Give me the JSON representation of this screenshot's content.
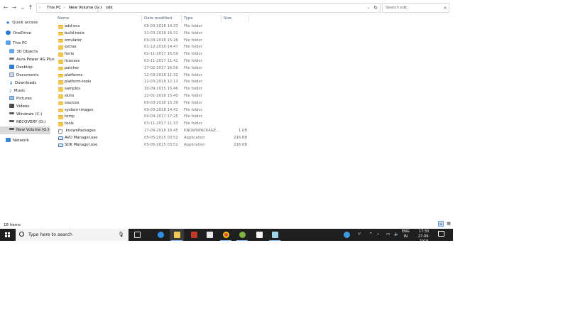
{
  "address_bar": {
    "back": "←",
    "forward": "→",
    "recent": "⌄",
    "up": "↑",
    "breadcrumbs": [
      "This PC",
      "New Volume (G:)",
      "sdk"
    ],
    "dropdown": "⌄",
    "refresh": "↻"
  },
  "search": {
    "placeholder": "Search sdk"
  },
  "nav": {
    "items": [
      {
        "label": "Quick access",
        "icon": "star-icon"
      },
      {
        "label": "OneDrive",
        "icon": "cloud-icon"
      },
      {
        "label": "This PC",
        "icon": "computer-icon"
      },
      {
        "label": "3D Objects",
        "icon": "cube-icon"
      },
      {
        "label": "Aura Power 4G Plus",
        "icon": "phone-drive-icon"
      },
      {
        "label": "Desktop",
        "icon": "desktop-icon"
      },
      {
        "label": "Documents",
        "icon": "documents-icon"
      },
      {
        "label": "Downloads",
        "icon": "download-icon"
      },
      {
        "label": "Music",
        "icon": "music-icon"
      },
      {
        "label": "Pictures",
        "icon": "pictures-icon"
      },
      {
        "label": "Videos",
        "icon": "videos-icon"
      },
      {
        "label": "Windows (C:)",
        "icon": "drive-icon"
      },
      {
        "label": "RECOVERY (D:)",
        "icon": "drive-icon"
      },
      {
        "label": "New Volume (G:)",
        "icon": "drive-icon"
      },
      {
        "label": "Network",
        "icon": "network-icon"
      }
    ]
  },
  "columns": {
    "name": "Name",
    "date": "Date modified",
    "type": "Type",
    "size": "Size"
  },
  "files": [
    {
      "name": "add-ons",
      "date": "09-03-2018 14:33",
      "type": "File folder",
      "size": "",
      "kind": "folder"
    },
    {
      "name": "build-tools",
      "date": "31-03-2018 16:31",
      "type": "File folder",
      "size": "",
      "kind": "folder"
    },
    {
      "name": "emulator",
      "date": "09-03-2018 15:26",
      "type": "File folder",
      "size": "",
      "kind": "folder"
    },
    {
      "name": "extras",
      "date": "01-12-2016 14:47",
      "type": "File folder",
      "size": "",
      "kind": "folder"
    },
    {
      "name": "fonts",
      "date": "02-11-2017 16:59",
      "type": "File folder",
      "size": "",
      "kind": "folder"
    },
    {
      "name": "licenses",
      "date": "03-11-2017 11:41",
      "type": "File folder",
      "size": "",
      "kind": "folder"
    },
    {
      "name": "patcher",
      "date": "17-02-2017 16:59",
      "type": "File folder",
      "size": "",
      "kind": "folder"
    },
    {
      "name": "platforms",
      "date": "12-03-2018 11:32",
      "type": "File folder",
      "size": "",
      "kind": "folder"
    },
    {
      "name": "platform-tools",
      "date": "22-03-2018 12:13",
      "type": "File folder",
      "size": "",
      "kind": "folder"
    },
    {
      "name": "samples",
      "date": "30-09-2015 15:46",
      "type": "File folder",
      "size": "",
      "kind": "folder"
    },
    {
      "name": "skins",
      "date": "22-01-2018 15:40",
      "type": "File folder",
      "size": "",
      "kind": "folder"
    },
    {
      "name": "sources",
      "date": "09-03-2018 15:39",
      "type": "File folder",
      "size": "",
      "kind": "folder"
    },
    {
      "name": "system-images",
      "date": "09-03-2018 14:42",
      "type": "File folder",
      "size": "",
      "kind": "folder"
    },
    {
      "name": "temp",
      "date": "04-04-2017 17:25",
      "type": "File folder",
      "size": "",
      "kind": "folder"
    },
    {
      "name": "tools",
      "date": "03-11-2017 11:33",
      "type": "File folder",
      "size": "",
      "kind": "folder"
    },
    {
      "name": ".knownPackages",
      "date": "27-09-2018 16:45",
      "type": "KNOWNPACKAGE...",
      "size": "1 KB",
      "kind": "file"
    },
    {
      "name": "AVD Manager.exe",
      "date": "05-05-2015 03:52",
      "type": "Application",
      "size": "216 KB",
      "kind": "app"
    },
    {
      "name": "SDK Manager.exe",
      "date": "05-05-2015 03:52",
      "type": "Application",
      "size": "216 KB",
      "kind": "app"
    }
  ],
  "status": {
    "count": "18 items"
  },
  "taskbar": {
    "search_placeholder": "Type here to search",
    "lang": "ENG",
    "region": "IN",
    "time": "17:33",
    "date": "27-09-2018"
  }
}
